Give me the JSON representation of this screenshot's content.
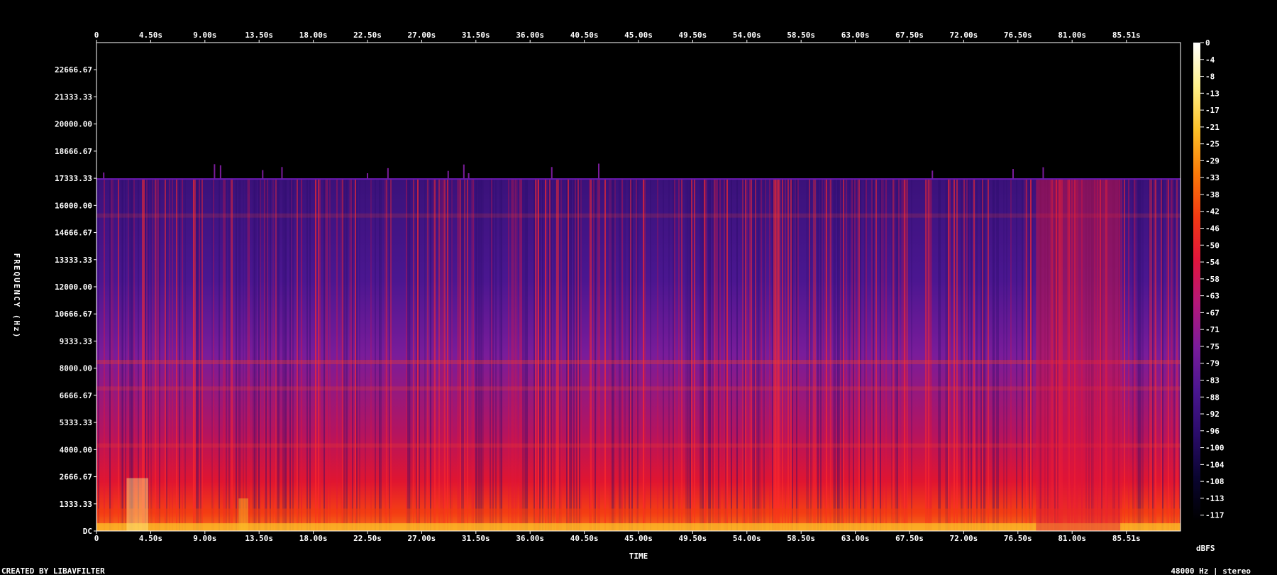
{
  "chart_data": {
    "type": "heatmap",
    "title": "",
    "xlabel": "TIME",
    "ylabel": "FREQUENCY (Hz)",
    "x_ticks": [
      "0",
      "4.50s",
      "9.00s",
      "13.50s",
      "18.00s",
      "22.50s",
      "27.00s",
      "31.50s",
      "36.00s",
      "40.50s",
      "45.00s",
      "49.50s",
      "54.00s",
      "58.50s",
      "63.00s",
      "67.50s",
      "72.00s",
      "76.50s",
      "81.00s",
      "85.51s"
    ],
    "x_tick_values": [
      0,
      4.5,
      9.0,
      13.5,
      18.0,
      22.5,
      27.0,
      31.5,
      36.0,
      40.5,
      45.0,
      49.5,
      54.0,
      58.5,
      63.0,
      67.5,
      72.0,
      76.5,
      81.0,
      85.51
    ],
    "xlim": [
      0,
      90.0
    ],
    "y_ticks": [
      "DC",
      "1333.33",
      "2666.67",
      "4000.00",
      "5333.33",
      "6666.67",
      "8000.00",
      "9333.33",
      "10666.67",
      "12000.00",
      "13333.33",
      "14666.67",
      "16000.00",
      "17333.33",
      "18666.67",
      "20000.00",
      "21333.33",
      "22666.67"
    ],
    "y_tick_values": [
      0,
      1333.33,
      2666.67,
      4000.0,
      5333.33,
      6666.67,
      8000.0,
      9333.33,
      10666.67,
      12000.0,
      13333.33,
      14666.67,
      16000.0,
      17333.33,
      18666.67,
      20000.0,
      21333.33,
      22666.67
    ],
    "ylim": [
      0,
      24000
    ],
    "cutoff_frequency_hz": 17300,
    "colorbar": {
      "label": "dBFS",
      "ticks": [
        "0",
        "-4",
        "-8",
        "-13",
        "-17",
        "-21",
        "-25",
        "-29",
        "-33",
        "-38",
        "-42",
        "-46",
        "-50",
        "-54",
        "-58",
        "-63",
        "-67",
        "-71",
        "-75",
        "-79",
        "-83",
        "-88",
        "-92",
        "-96",
        "-100",
        "-104",
        "-108",
        "-113",
        "-117"
      ],
      "range": [
        -120,
        0
      ],
      "colors": [
        "#000000",
        "#0a0530",
        "#2a0c6a",
        "#4a1690",
        "#7a1c9a",
        "#b4187a",
        "#e0153c",
        "#f23a12",
        "#fa7a08",
        "#fcc028",
        "#fff08a",
        "#ffffff"
      ]
    },
    "heat_bands": [
      {
        "x": [
          2.5,
          4.3
        ],
        "y": [
          0,
          2600
        ],
        "level": -12
      },
      {
        "x": [
          11.8,
          12.6
        ],
        "y": [
          0,
          1600
        ],
        "level": -25
      },
      {
        "x": [
          78.0,
          85.0
        ],
        "y": [
          0,
          17300
        ],
        "level": -58
      }
    ]
  },
  "footer": {
    "credit": "CREATED BY LIBAVFILTER",
    "format": "48000 Hz | stereo"
  }
}
